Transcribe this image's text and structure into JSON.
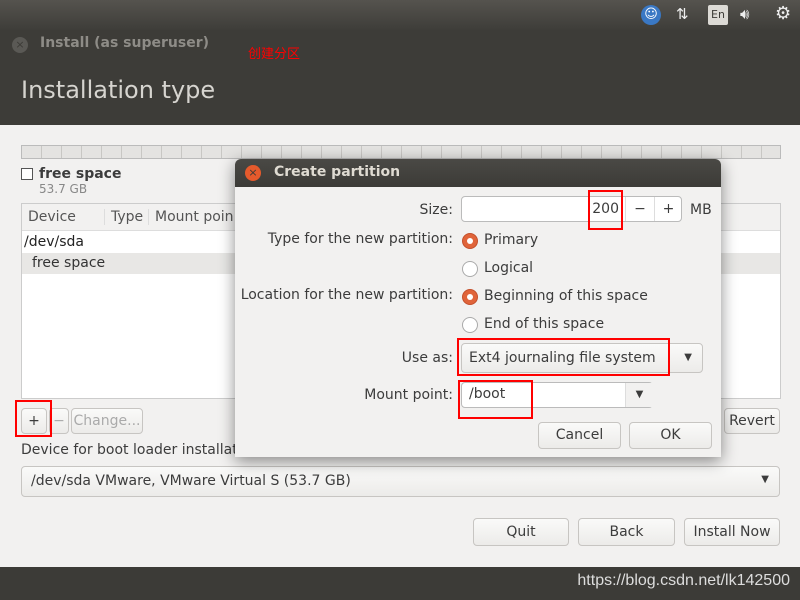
{
  "top_panel": {
    "icons": [
      "accessibility-icon",
      "network-icon",
      "keyboard-layout-icon",
      "volume-icon",
      "settings-icon"
    ],
    "keyboard_layout": "En"
  },
  "window": {
    "title": "Install (as superuser)",
    "page_title": "Installation type"
  },
  "annotation": {
    "caption": "创建分区",
    "color": "#ff0000"
  },
  "partition_bar": {
    "label": "free space",
    "size": "53.7 GB"
  },
  "table": {
    "columns": [
      "Device",
      "Type",
      "Mount poin"
    ],
    "rows": [
      "/dev/sda",
      "free space"
    ]
  },
  "toolbar": {
    "add": "+",
    "remove": "−",
    "change": "Change...",
    "revert": "Revert"
  },
  "bootloader": {
    "label": "Device for boot loader installat",
    "value": "/dev/sda VMware, VMware Virtual S (53.7 GB)"
  },
  "buttons": {
    "quit": "Quit",
    "back": "Back",
    "install": "Install Now"
  },
  "watermark": "https://blog.csdn.net/lk142500",
  "dialog": {
    "title": "Create partition",
    "size_label": "Size:",
    "size_value": "200",
    "size_unit": "MB",
    "minus": "−",
    "plus": "+",
    "type_label": "Type for the new partition:",
    "type_options": [
      "Primary",
      "Logical"
    ],
    "type_selected": "Primary",
    "location_label": "Location for the new partition:",
    "location_options": [
      "Beginning of this space",
      "End of this space"
    ],
    "location_selected": "Beginning of this space",
    "use_as_label": "Use as:",
    "use_as_value": "Ext4 journaling file system",
    "mount_label": "Mount point:",
    "mount_value": "/boot",
    "cancel": "Cancel",
    "ok": "OK"
  },
  "colors": {
    "accent": "#e0643a",
    "dark": "#3c3b37",
    "background": "#f2f1f0"
  }
}
